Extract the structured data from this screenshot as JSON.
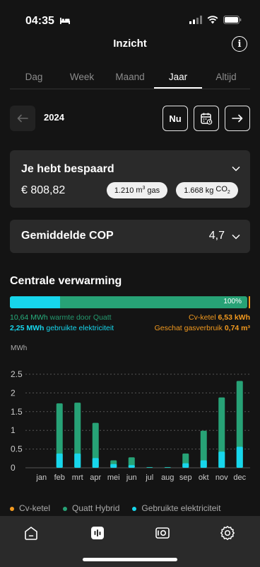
{
  "status_bar": {
    "time": "04:35"
  },
  "header": {
    "title": "Inzicht",
    "info_label": "i"
  },
  "tabs": [
    {
      "label": "Dag",
      "active": false
    },
    {
      "label": "Week",
      "active": false
    },
    {
      "label": "Maand",
      "active": false
    },
    {
      "label": "Jaar",
      "active": true
    },
    {
      "label": "Altijd",
      "active": false
    }
  ],
  "period": {
    "year": "2024",
    "now_label": "Nu"
  },
  "savings": {
    "title": "Je hebt bespaard",
    "amount": "€ 808,82",
    "gas_value": "1.210",
    "gas_unit": "m",
    "gas_sup": "3",
    "gas_label": "gas",
    "co2_value": "1.668",
    "co2_unit": "kg",
    "co2_label": "CO",
    "co2_sub": "2"
  },
  "cop": {
    "title": "Gemiddelde COP",
    "value": "4,7"
  },
  "heating": {
    "title": "Centrale verwarming",
    "progress_percent": "100%",
    "electricity_fraction": 0.211,
    "heat_value": "10,64 MWh",
    "heat_label": "warmte door Quatt",
    "electricity_value": "2,25 MWh",
    "electricity_label": "gebruikte elektriciteit",
    "boiler_label": "Cv-ketel",
    "boiler_value": "6,53 kWh",
    "gas_label": "Geschat gasverbruik",
    "gas_value": "0,74 m³"
  },
  "colors": {
    "quatt_green": "#27a276",
    "electricity_cyan": "#17d6ec",
    "boiler_orange": "#f39a1f",
    "card_bg": "#2a2a2a"
  },
  "chart_data": {
    "type": "bar",
    "unit": "MWh",
    "categories": [
      "jan",
      "feb",
      "mrt",
      "apr",
      "mei",
      "jun",
      "jul",
      "aug",
      "sep",
      "okt",
      "nov",
      "dec"
    ],
    "series": [
      {
        "name": "Cv-ketel",
        "values": [
          0,
          0,
          0,
          0,
          0,
          0,
          0,
          0,
          0,
          0,
          0,
          0
        ]
      },
      {
        "name": "Quatt Hybrid",
        "values": [
          0,
          1.72,
          1.74,
          1.2,
          0.2,
          0.28,
          0.02,
          0.02,
          0.38,
          0.99,
          1.88,
          2.32
        ]
      },
      {
        "name": "Gebruikte elektriciteit",
        "values": [
          0,
          0.38,
          0.38,
          0.26,
          0.1,
          0.07,
          0.01,
          0.01,
          0.12,
          0.2,
          0.43,
          0.56
        ]
      }
    ],
    "yticks": [
      "0",
      "0.5",
      "1",
      "1.5",
      "2",
      "2.5"
    ],
    "ylim": [
      0,
      2.5
    ],
    "legend_position": "bottom"
  },
  "bottom_nav": [
    {
      "icon": "home-icon"
    },
    {
      "icon": "insights-icon",
      "active": true
    },
    {
      "icon": "device-icon"
    },
    {
      "icon": "settings-icon"
    }
  ]
}
